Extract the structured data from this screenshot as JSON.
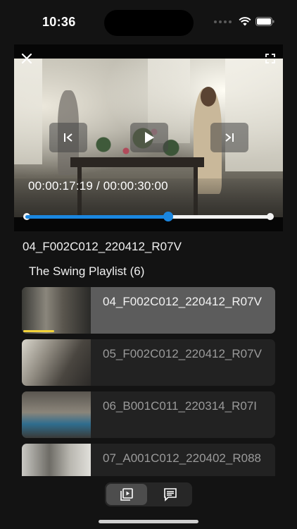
{
  "status_bar": {
    "time": "10:36"
  },
  "player": {
    "timecode": "00:00:17:19 / 00:00:30:00",
    "progress_fraction": 0.58
  },
  "current_clip": {
    "title": "04_F002C012_220412_R07V"
  },
  "playlist": {
    "title": "The Swing Playlist (6)",
    "items": [
      {
        "label": "04_F002C012_220412_R07V",
        "active": true
      },
      {
        "label": "05_F002C012_220412_R07V",
        "active": false
      },
      {
        "label": "06_B001C011_220314_R07I",
        "active": false
      },
      {
        "label": "07_A001C012_220402_R088",
        "active": false
      }
    ]
  },
  "bottom_tabs": [
    {
      "icon": "playlist-icon",
      "selected": true
    },
    {
      "icon": "comments-icon",
      "selected": false
    }
  ],
  "colors": {
    "accent": "#1a86e0",
    "progress_marker": "#f1d23a",
    "background": "#131313"
  }
}
